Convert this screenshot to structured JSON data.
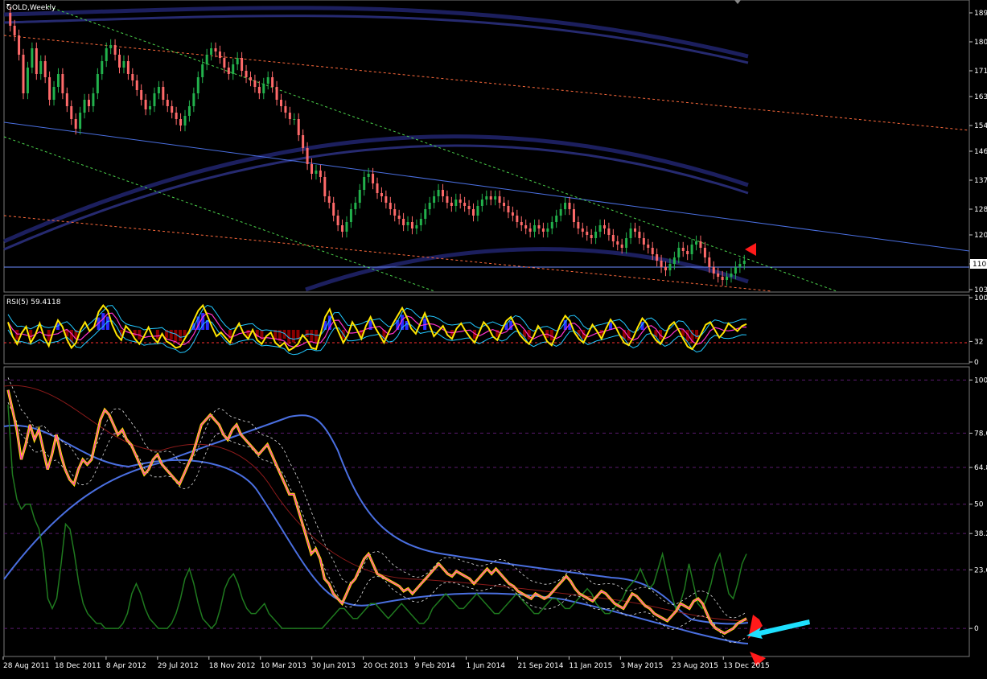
{
  "window": {
    "title": "GOLD,Weekly"
  },
  "colors": {
    "background": "#000000",
    "bull": "#22b14c",
    "bear": "#ff6a6a",
    "band": "#2a2f7a",
    "channel": "#4a6fe0",
    "fib": "#ff6a3c",
    "trend_green": "#4cd34c",
    "rsi": "#ffe600",
    "magenta": "#ff33cc",
    "cyan": "#22c8ff",
    "hist_pos": "#2b2bff",
    "hist_neg": "#8b0000",
    "annot_red": "#ff1a1a",
    "annot_cyan": "#1ee0ff"
  },
  "chart_data": [
    {
      "id": "main",
      "type": "candlestick",
      "title": "GOLD,Weekly",
      "ylim": [
        1030,
        1920
      ],
      "y_ticks": [
        "189",
        "180",
        "171",
        "163",
        "154",
        "146",
        "137",
        "128",
        "120",
        "110",
        "103"
      ],
      "y_tick_values": [
        1890,
        1800,
        1710,
        1630,
        1540,
        1460,
        1370,
        1280,
        1200,
        1110,
        1030
      ],
      "price_marker": "110",
      "price_marker_value": 1110,
      "x_labels": [
        "28 Aug 2011",
        "18 Dec 2011",
        "8 Apr 2012",
        "29 Jul 2012",
        "18 Nov 2012",
        "10 Mar 2013",
        "30 Jun 2013",
        "20 Oct 2013",
        "9 Feb 2014",
        "1 Jun 2014",
        "21 Sep 2014",
        "11 Jan 2015",
        "3 May 2015",
        "23 Aug 2015",
        "13 Dec 2015"
      ],
      "series": [
        {
          "name": "",
          "close": [
            1850,
            1820,
            1760,
            1640,
            1720,
            1780,
            1700,
            1740,
            1690,
            1620,
            1660,
            1700,
            1640,
            1600,
            1560,
            1530,
            1580,
            1620,
            1600,
            1640,
            1700,
            1740,
            1780,
            1790,
            1760,
            1720,
            1740,
            1700,
            1680,
            1650,
            1620,
            1590,
            1600,
            1640,
            1660,
            1620,
            1600,
            1580,
            1560,
            1540,
            1570,
            1600,
            1640,
            1690,
            1730,
            1760,
            1780,
            1770,
            1750,
            1720,
            1700,
            1730,
            1750,
            1710,
            1690,
            1680,
            1660,
            1640,
            1670,
            1690,
            1660,
            1620,
            1600,
            1580,
            1560,
            1560,
            1510,
            1470,
            1420,
            1390,
            1400,
            1380,
            1320,
            1300,
            1260,
            1230,
            1210,
            1240,
            1280,
            1300,
            1340,
            1380,
            1390,
            1360,
            1330,
            1320,
            1300,
            1280,
            1260,
            1250,
            1230,
            1240,
            1220,
            1230,
            1250,
            1280,
            1300,
            1320,
            1340,
            1320,
            1300,
            1290,
            1310,
            1300,
            1290,
            1280,
            1260,
            1290,
            1310,
            1320,
            1310,
            1320,
            1300,
            1290,
            1270,
            1260,
            1240,
            1230,
            1220,
            1210,
            1230,
            1220,
            1210,
            1220,
            1240,
            1260,
            1280,
            1300,
            1280,
            1240,
            1220,
            1210,
            1200,
            1190,
            1210,
            1230,
            1220,
            1200,
            1180,
            1170,
            1160,
            1190,
            1220,
            1210,
            1190,
            1170,
            1160,
            1140,
            1120,
            1100,
            1090,
            1110,
            1130,
            1160,
            1150,
            1140,
            1170,
            1180,
            1160,
            1130,
            1100,
            1080,
            1070,
            1060,
            1070,
            1080,
            1100,
            1110,
            1120
          ]
        }
      ],
      "annotation": "red-arrow-left"
    },
    {
      "id": "rsi",
      "type": "line",
      "title": "RSI(5) 59.4118",
      "ylim": [
        0,
        100
      ],
      "y_ticks": [
        "100",
        "32",
        "0"
      ],
      "y_tick_values": [
        100,
        32,
        0
      ],
      "level": 32,
      "series": [
        {
          "name": "RSI(5) 59.4118",
          "values": [
            62,
            40,
            28,
            45,
            55,
            30,
            42,
            60,
            38,
            25,
            48,
            65,
            55,
            35,
            22,
            30,
            50,
            62,
            48,
            55,
            78,
            88,
            80,
            58,
            42,
            34,
            56,
            48,
            36,
            28,
            40,
            54,
            38,
            30,
            44,
            32,
            28,
            22,
            24,
            36,
            48,
            65,
            80,
            88,
            72,
            55,
            40,
            46,
            38,
            30,
            48,
            60,
            44,
            36,
            50,
            34,
            28,
            40,
            46,
            30,
            24,
            30,
            18,
            22,
            28,
            42,
            34,
            22,
            20,
            44,
            70,
            82,
            62,
            46,
            30,
            42,
            62,
            50,
            36,
            56,
            70,
            54,
            42,
            30,
            46,
            60,
            72,
            84,
            70,
            52,
            44,
            60,
            76,
            58,
            40,
            48,
            56,
            42,
            36,
            52,
            60,
            48,
            38,
            30,
            46,
            62,
            54,
            40,
            34,
            50,
            64,
            70,
            56,
            42,
            34,
            28,
            40,
            56,
            46,
            32,
            26,
            42,
            60,
            72,
            64,
            46,
            36,
            30,
            44,
            58,
            48,
            36,
            52,
            66,
            56,
            42,
            30,
            26,
            38,
            54,
            68,
            60,
            44,
            34,
            28,
            40,
            56,
            62,
            50,
            36,
            24,
            20,
            30,
            44,
            58,
            62,
            50,
            38,
            46,
            60,
            54,
            48,
            56,
            59
          ]
        }
      ]
    },
    {
      "id": "stoch",
      "type": "line",
      "ylim": [
        -10,
        104
      ],
      "y_ticks": [
        "100",
        "78.6",
        "64.8",
        "50",
        "38.2",
        "23.6",
        "0"
      ],
      "y_tick_values": [
        100,
        78.6,
        64.8,
        50,
        38.2,
        23.6,
        0
      ],
      "series": [
        {
          "name": "",
          "values": [
            96,
            88,
            80,
            68,
            74,
            82,
            76,
            80,
            72,
            64,
            70,
            78,
            70,
            64,
            60,
            58,
            64,
            68,
            66,
            68,
            76,
            84,
            88,
            86,
            82,
            78,
            80,
            76,
            74,
            70,
            66,
            62,
            64,
            68,
            70,
            66,
            64,
            62,
            60,
            58,
            62,
            66,
            70,
            76,
            82,
            84,
            86,
            84,
            82,
            78,
            76,
            80,
            82,
            78,
            76,
            74,
            72,
            70,
            72,
            74,
            70,
            66,
            62,
            58,
            54,
            54,
            48,
            42,
            36,
            30,
            32,
            28,
            20,
            18,
            14,
            12,
            10,
            14,
            18,
            20,
            24,
            28,
            30,
            26,
            22,
            21,
            20,
            19,
            18,
            17,
            15,
            16,
            14,
            16,
            18,
            20,
            22,
            24,
            26,
            24,
            22,
            21,
            23,
            22,
            21,
            20,
            18,
            20,
            22,
            24,
            22,
            24,
            22,
            20,
            18,
            17,
            15,
            14,
            13,
            12,
            14,
            13,
            12,
            13,
            15,
            17,
            19,
            21,
            19,
            16,
            14,
            13,
            12,
            11,
            13,
            15,
            14,
            12,
            10,
            9,
            8,
            11,
            14,
            13,
            11,
            9,
            8,
            6,
            5,
            4,
            3,
            5,
            7,
            10,
            9,
            8,
            11,
            12,
            10,
            6,
            2,
            0,
            -1,
            -2,
            -1,
            0,
            2,
            3,
            4
          ]
        },
        {
          "name": "",
          "values": [
            90,
            62,
            52,
            48,
            50,
            50,
            44,
            40,
            30,
            12,
            8,
            12,
            26,
            42,
            40,
            30,
            18,
            10,
            6,
            4,
            2,
            2,
            0,
            0,
            0,
            0,
            2,
            6,
            14,
            18,
            14,
            8,
            4,
            2,
            0,
            0,
            0,
            2,
            6,
            12,
            20,
            24,
            18,
            10,
            4,
            2,
            0,
            2,
            8,
            16,
            20,
            22,
            18,
            12,
            8,
            6,
            6,
            8,
            10,
            6,
            4,
            2,
            0,
            0,
            0,
            0,
            0,
            0,
            0,
            0,
            0,
            0,
            2,
            4,
            6,
            8,
            8,
            6,
            4,
            4,
            6,
            8,
            10,
            10,
            8,
            6,
            4,
            6,
            8,
            10,
            8,
            6,
            4,
            2,
            2,
            4,
            8,
            10,
            12,
            14,
            12,
            10,
            8,
            8,
            10,
            12,
            14,
            12,
            10,
            8,
            6,
            6,
            8,
            10,
            12,
            14,
            12,
            10,
            8,
            6,
            6,
            8,
            10,
            12,
            12,
            10,
            8,
            8,
            10,
            12,
            14,
            16,
            14,
            10,
            8,
            6,
            6,
            8,
            10,
            12,
            16,
            18,
            20,
            24,
            20,
            16,
            18,
            24,
            30,
            22,
            14,
            8,
            10,
            16,
            26,
            18,
            10,
            8,
            12,
            18,
            26,
            30,
            22,
            14,
            12,
            18,
            26,
            30
          ]
        }
      ],
      "annotations": [
        "red-arrow-down",
        "cyan-arrow-left",
        "red-arrow-down-bottom"
      ]
    }
  ]
}
